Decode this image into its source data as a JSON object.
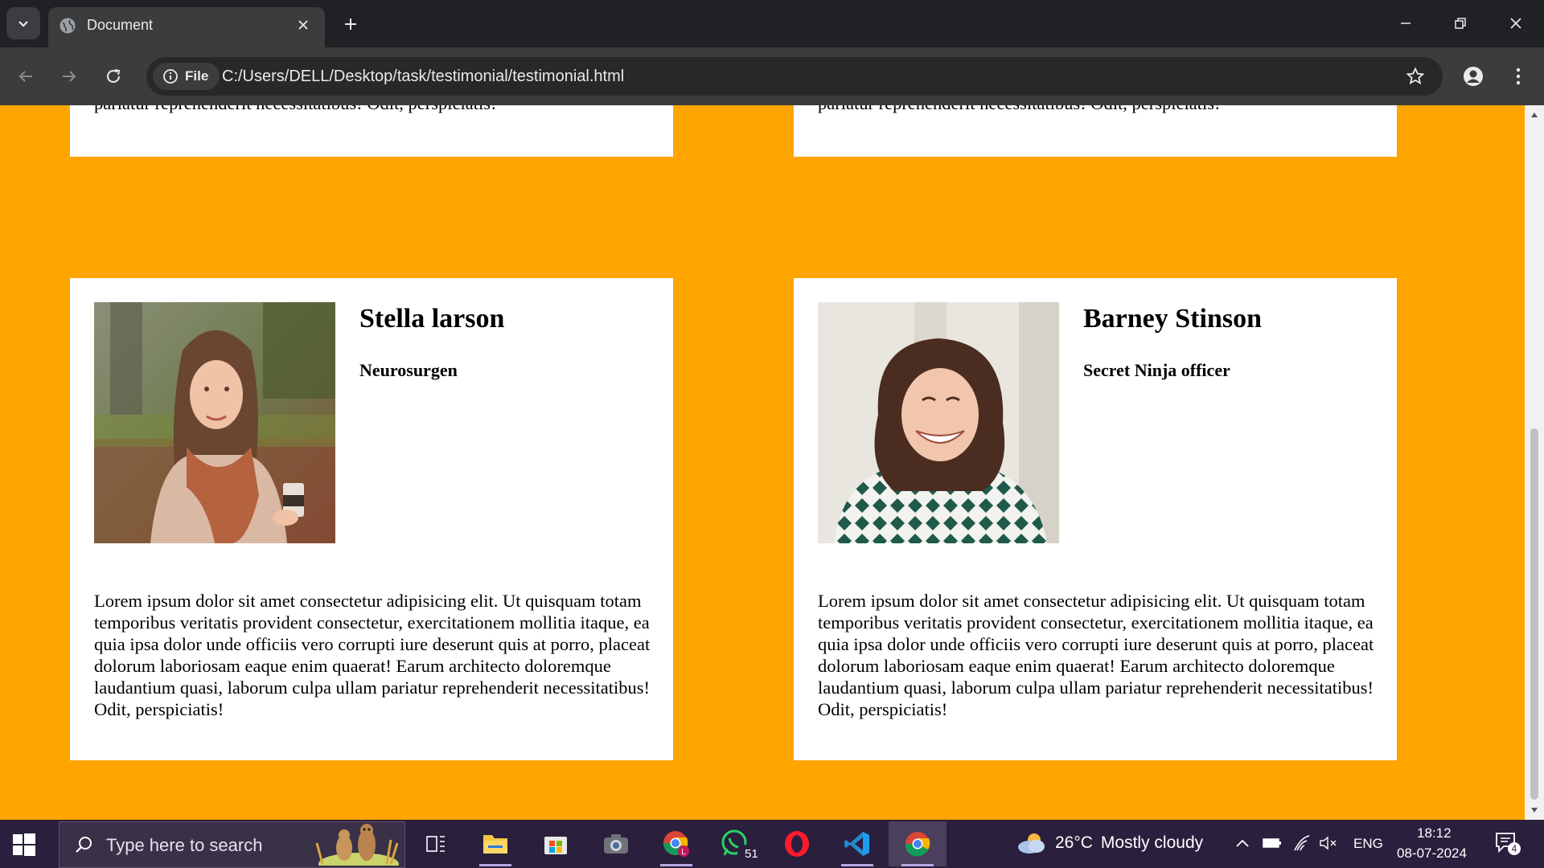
{
  "browser": {
    "tab_title": "Document",
    "file_chip_label": "File",
    "url": "C:/Users/DELL/Desktop/task/testimonial/testimonial.html"
  },
  "page": {
    "background_color": "#ffa500",
    "top_cards": [
      {
        "text_tail": "pariatur reprehenderit necessitatibus! Odit, perspiciatis!"
      },
      {
        "text_tail": "pariatur reprehenderit necessitatibus! Odit, perspiciatis!"
      }
    ],
    "testimonials": [
      {
        "name": "Stella larson",
        "role": "Neurosurgen",
        "text": "Lorem ipsum dolor sit amet consectetur adipisicing elit. Ut quisquam totam temporibus veritatis provident consectetur, exercitationem mollitia itaque, ea quia ipsa dolor unde officiis vero corrupti iure deserunt quis at porro, placeat dolorum laboriosam eaque enim quaerat! Earum architecto doloremque laudantium quasi, laborum culpa ullam pariatur reprehenderit necessitatibus! Odit, perspiciatis!"
      },
      {
        "name": "Barney Stinson",
        "role": "Secret Ninja officer",
        "text": "Lorem ipsum dolor sit amet consectetur adipisicing elit. Ut quisquam totam temporibus veritatis provident consectetur, exercitationem mollitia itaque, ea quia ipsa dolor unde officiis vero corrupti iure deserunt quis at porro, placeat dolorum laboriosam eaque enim quaerat! Earum architecto doloremque laudantium quasi, laborum culpa ullam pariatur reprehenderit necessitatibus! Odit, perspiciatis!"
      }
    ]
  },
  "taskbar": {
    "search_placeholder": "Type here to search",
    "whatsapp_badge": "51",
    "weather_temp": "26°C",
    "weather_desc": "Mostly cloudy",
    "language": "ENG",
    "time": "18:12",
    "date": "08-07-2024",
    "notification_count": "4"
  }
}
